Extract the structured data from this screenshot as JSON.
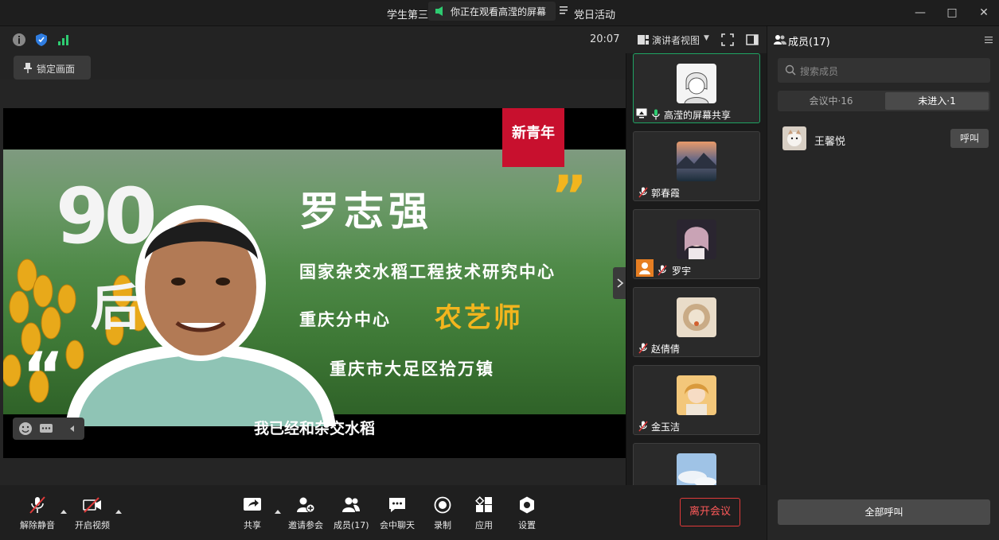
{
  "titlebar": {
    "title_left": "学生第三",
    "title_right": "党日活动",
    "share_banner": "你正在观看高滢的屏幕",
    "minimize_icon": "minimize-icon",
    "maximize_icon": "maximize-icon",
    "close_icon": "close-icon"
  },
  "video_header": {
    "clock": "20:07",
    "lock_label": "锁定画面"
  },
  "shared_screen": {
    "brand": "新青年",
    "big_number": "90",
    "big_suffix": "后",
    "name": "罗志强",
    "line1": "国家杂交水稻工程技术研究中心",
    "line2": "重庆分中心",
    "line2_highlight": "农艺师",
    "line3": "重庆市大足区拾万镇",
    "caption": "我已经和杂交水稻",
    "quote_open": "“",
    "quote_close": "”"
  },
  "gallery": {
    "view_label": "演讲者视图",
    "tiles": [
      {
        "name": "高滢的屏幕共享"
      },
      {
        "name": "郭春霞"
      },
      {
        "name": "罗宇"
      },
      {
        "name": "赵倩倩"
      },
      {
        "name": "金玉洁"
      }
    ]
  },
  "members_panel": {
    "title": "成员(17)",
    "search_placeholder": "搜索成员",
    "tab_in_meeting": "会议中·16",
    "tab_not_joined": "未进入·1",
    "members": [
      {
        "name": "王馨悦",
        "action": "呼叫"
      }
    ],
    "call_all": "全部呼叫"
  },
  "toolbar": {
    "unmute": "解除静音",
    "start_video": "开启视频",
    "share": "共享",
    "invite": "邀请参会",
    "members": "成员(17)",
    "chat": "会中聊天",
    "record": "录制",
    "apps": "应用",
    "settings": "设置",
    "leave": "离开会议"
  },
  "colors": {
    "accent_green": "#1fa363",
    "leave_red": "#e03a3a",
    "brand_red": "#c8102e",
    "highlight_yellow": "#f2b51e"
  }
}
